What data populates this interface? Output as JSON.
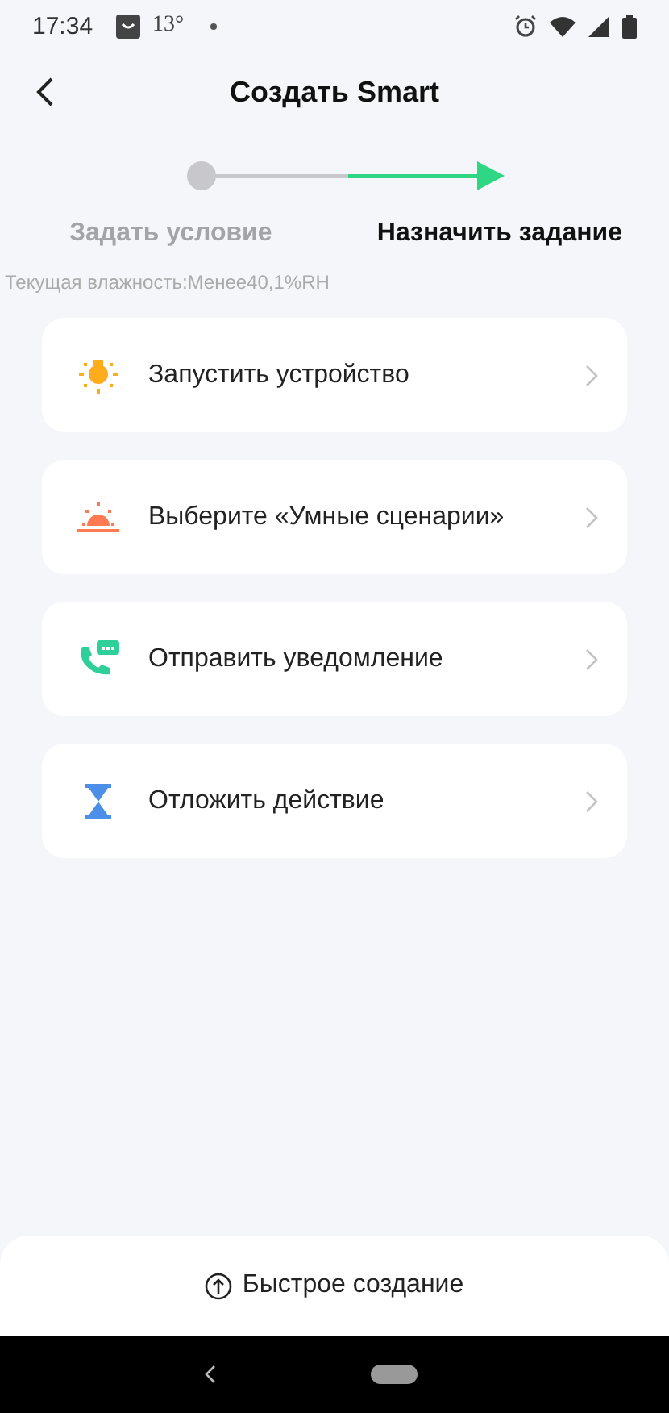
{
  "status_bar": {
    "time": "17:34",
    "temperature": "13°"
  },
  "header": {
    "title": "Создать Smart"
  },
  "steps": [
    {
      "label": "Задать условие",
      "selected": false
    },
    {
      "label": "Назначить задание",
      "selected": true
    }
  ],
  "condition_note": "Текущая влажность:Менее40,1%RH",
  "actions": [
    {
      "kind": "device",
      "label": "Запустить устройство"
    },
    {
      "kind": "scene",
      "label": "Выберите «Умные сценарии»"
    },
    {
      "kind": "notify",
      "label": "Отправить уведомление"
    },
    {
      "kind": "delay",
      "label": "Отложить действие"
    }
  ],
  "quick_create": {
    "label": "Быстрое создание"
  }
}
